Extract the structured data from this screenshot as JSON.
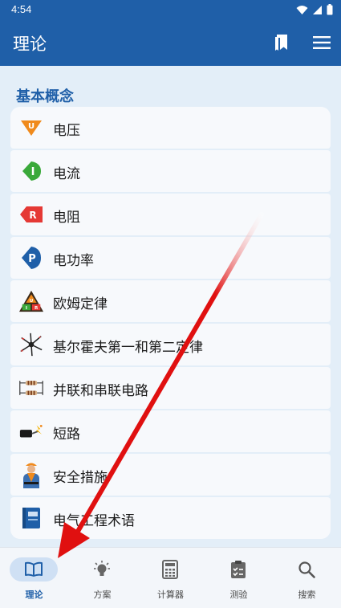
{
  "status": {
    "time": "4:54"
  },
  "appbar": {
    "title": "理论"
  },
  "section": {
    "title": "基本概念"
  },
  "items": [
    {
      "label": "电压",
      "icon": "u-icon",
      "letter": "U",
      "color": "#f08a1c"
    },
    {
      "label": "电流",
      "icon": "i-icon",
      "letter": "I",
      "color": "#3aa93a"
    },
    {
      "label": "电阻",
      "icon": "r-icon",
      "letter": "R",
      "color": "#e53935"
    },
    {
      "label": "电功率",
      "icon": "p-icon",
      "letter": "P",
      "color": "#1f5fa8"
    },
    {
      "label": "欧姆定律",
      "icon": "ohms-law-triangle-icon"
    },
    {
      "label": "基尔霍夫第一和第二定律",
      "icon": "kirchhoff-node-icon"
    },
    {
      "label": "并联和串联电路",
      "icon": "resistors-circuit-icon"
    },
    {
      "label": "短路",
      "icon": "short-circuit-spark-icon"
    },
    {
      "label": "安全措施",
      "icon": "electrician-worker-icon"
    },
    {
      "label": "电气工程术语",
      "icon": "terminology-book-icon"
    }
  ],
  "nav": [
    {
      "label": "理论",
      "icon": "book-icon",
      "active": true
    },
    {
      "label": "方案",
      "icon": "lightbulb-icon",
      "active": false
    },
    {
      "label": "计算器",
      "icon": "calculator-icon",
      "active": false
    },
    {
      "label": "测验",
      "icon": "clipboard-check-icon",
      "active": false
    },
    {
      "label": "搜索",
      "icon": "search-icon",
      "active": false
    }
  ],
  "colors": {
    "primary": "#1f5fa8",
    "annotation": "#e01010"
  }
}
